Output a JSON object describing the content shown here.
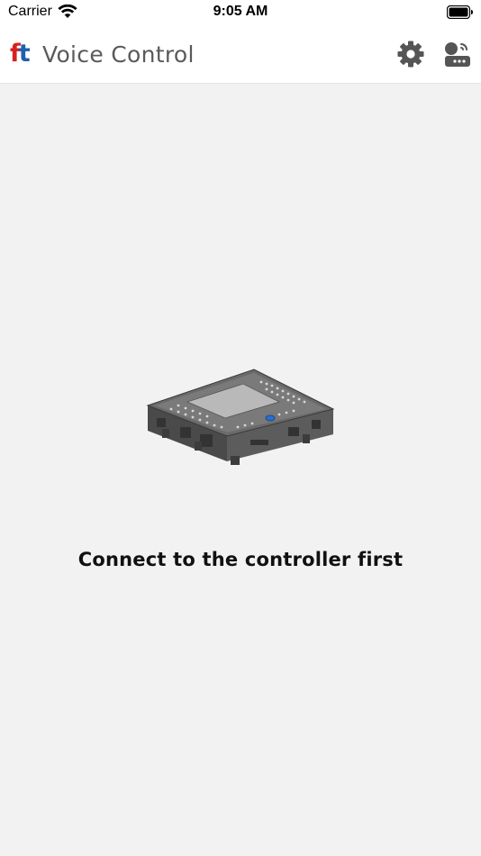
{
  "status_bar": {
    "carrier": "Carrier",
    "time": "9:05 AM",
    "icons": [
      "wifi-icon",
      "battery-icon"
    ]
  },
  "header": {
    "logo": {
      "letter1": "f",
      "letter2": "t",
      "color1": "#d92020",
      "color2": "#1f5fb0"
    },
    "title": "Voice Control",
    "actions": [
      "gear-icon",
      "router-connection-icon"
    ]
  },
  "main": {
    "image": "ft-controller-image",
    "message": "Connect to the controller first"
  },
  "colors": {
    "background": "#f2f2f2",
    "header_bg": "#ffffff",
    "title_text": "#5a5a5a",
    "icon": "#555555"
  }
}
